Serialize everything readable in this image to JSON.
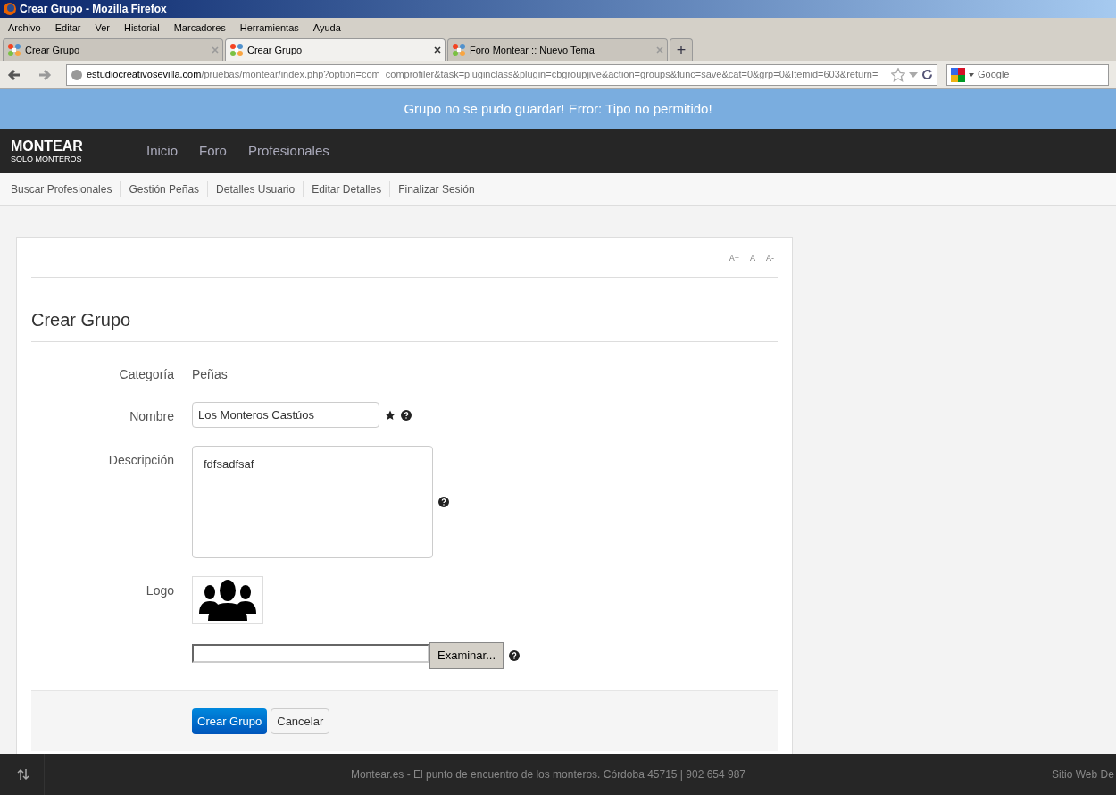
{
  "window": {
    "title": "Crear Grupo - Mozilla Firefox"
  },
  "menu": [
    "Archivo",
    "Editar",
    "Ver",
    "Historial",
    "Marcadores",
    "Herramientas",
    "Ayuda"
  ],
  "tabs": [
    {
      "label": "Crear Grupo",
      "selected": false
    },
    {
      "label": "Crear Grupo",
      "selected": true
    },
    {
      "label": "Foro Montear :: Nuevo Tema",
      "selected": false
    }
  ],
  "new_tab": "+",
  "address": {
    "domain": "estudiocreativosevilla.com",
    "path": "/pruebas/montear/index.php?option=com_comprofiler&task=pluginclass&plugin=cbgroupjive&action=groups&func=save&cat=0&grp=0&Itemid=603&return="
  },
  "search": {
    "placeholder": "Google"
  },
  "alert": "Grupo no se pudo guardar! Error: Tipo no permitido!",
  "brand": {
    "name": "MONTEAR",
    "tagline": "SÓLO MONTEROS"
  },
  "nav": [
    "Inicio",
    "Foro",
    "Profesionales"
  ],
  "subnav": [
    "Buscar Profesionales",
    "Gestión Peñas",
    "Detalles Usuario",
    "Editar Detalles",
    "Finalizar Sesión"
  ],
  "font_sizes": [
    "A+",
    "A",
    "A-"
  ],
  "heading": "Crear Grupo",
  "fields": [
    {
      "kind": "static",
      "label": "Categoría",
      "value": "Peñas"
    },
    {
      "kind": "text",
      "label": "Nombre",
      "value": "Los Monteros Castúos",
      "required": true,
      "help": true
    },
    {
      "kind": "textarea",
      "label": "Descripción",
      "value": "fdfsadfsaf",
      "required": false,
      "help": true
    },
    {
      "kind": "logo",
      "label": "Logo"
    },
    {
      "kind": "file",
      "button": "Examinar...",
      "help": true
    }
  ],
  "buttons": {
    "submit": "Crear Grupo",
    "cancel": "Cancelar"
  },
  "footer": {
    "text": "Montear.es - El punto de encuentro de los monteros. Córdoba 45715 | 902 654 987",
    "right": "Sitio Web De"
  }
}
